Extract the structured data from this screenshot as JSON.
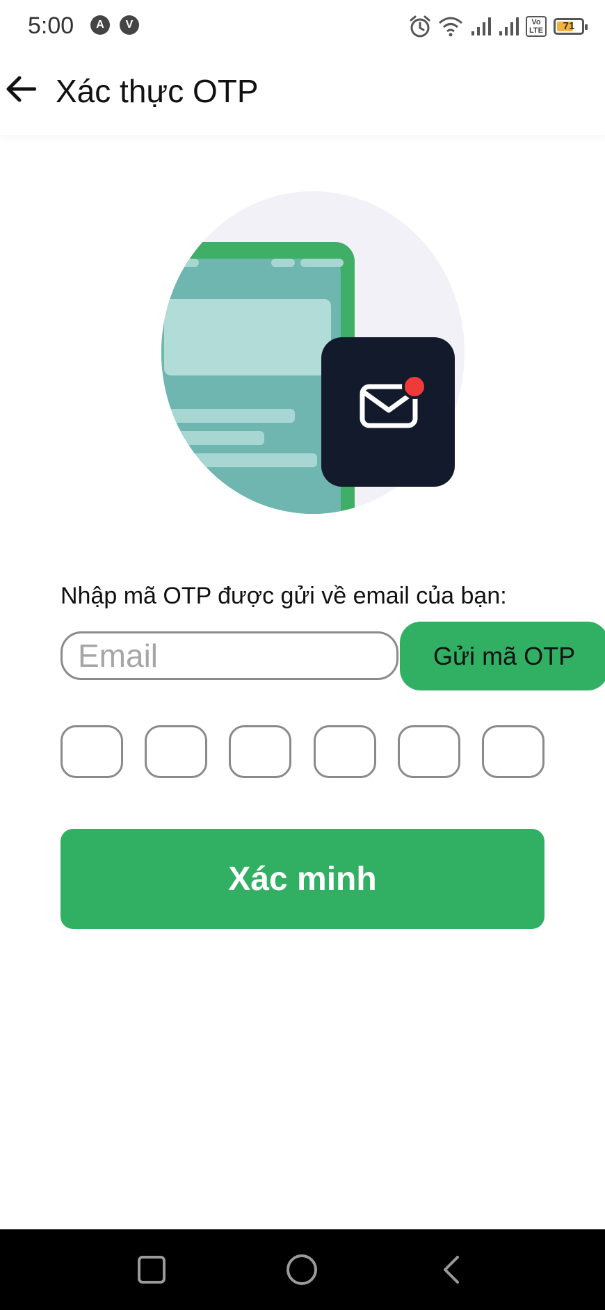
{
  "status_bar": {
    "time": "5:00",
    "app_icons": [
      "A",
      "V"
    ],
    "lte_label_top": "Vo",
    "lte_label_bottom": "LTE",
    "battery_level": "71",
    "battery_fraction": 0.71,
    "battery_color": "#f4b23c"
  },
  "header": {
    "title": "Xác thực OTP",
    "back_icon": "back-arrow-icon"
  },
  "illustration": {
    "description_icon": "mail-notification-icon",
    "accent_color": "#31b064",
    "badge_color": "#f03a3a"
  },
  "form": {
    "prompt": "Nhập mã OTP được gửi về email của bạn:",
    "email_placeholder": "Email",
    "email_value": "",
    "send_otp_label": "Gửi mã OTP",
    "otp_digits": [
      "",
      "",
      "",
      "",
      "",
      ""
    ],
    "verify_label": "Xác minh"
  },
  "theme": {
    "primary": "#31b064",
    "border": "#8a8a8a"
  },
  "nav_bar": {
    "icons": [
      "recents-icon",
      "home-icon",
      "back-icon"
    ]
  }
}
